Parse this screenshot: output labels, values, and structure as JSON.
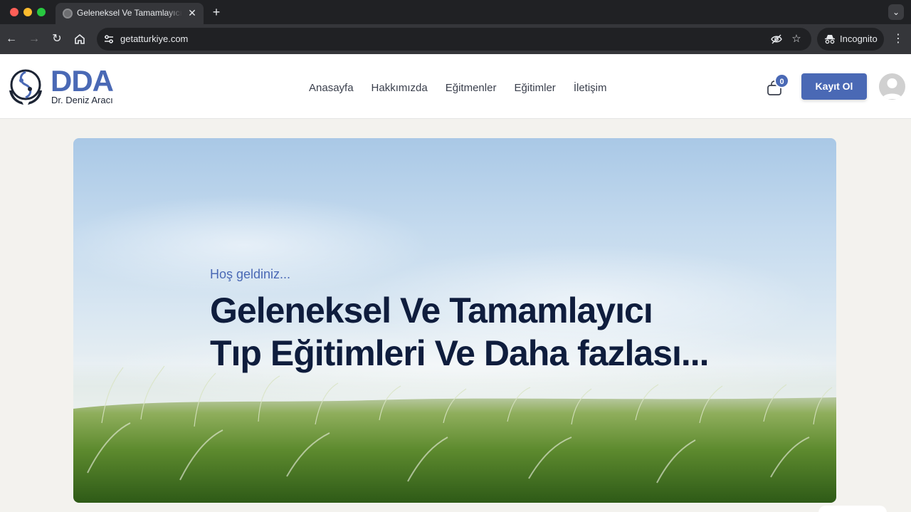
{
  "browser": {
    "tab_title": "Geleneksel Ve Tamamlayıcı Tıp Eğitimleri",
    "url": "getatturkiye.com",
    "incognito_label": "Incognito"
  },
  "site": {
    "logo_text": "DDA",
    "logo_subtitle": "Dr. Deniz Aracı",
    "nav": [
      "Anasayfa",
      "Hakkımızda",
      "Eğitmenler",
      "Eğitimler",
      "İletişim"
    ],
    "cart_count": "0",
    "signup_label": "Kayıt Ol"
  },
  "hero": {
    "greeting": "Hoş geldiniz...",
    "title_line1": "Geleneksel Ve Tamamlayıcı",
    "title_line2": "Tıp Eğitimleri Ve Daha fazlası..."
  },
  "colors": {
    "brand": "#4a69b5",
    "heading": "#0f1d3d",
    "chrome_dark": "#202124"
  }
}
